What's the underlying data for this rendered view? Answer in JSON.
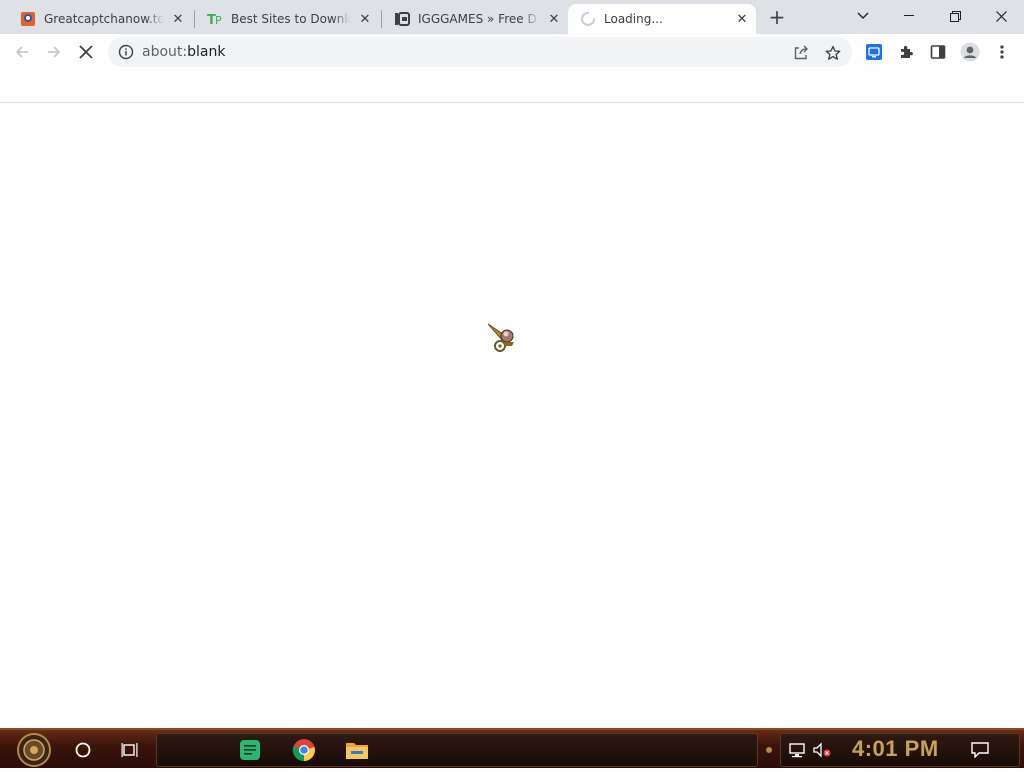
{
  "browser": {
    "tabs": [
      {
        "title": "Greatcaptchanow.top",
        "favicon": "captcha-favicon",
        "active": false
      },
      {
        "title": "Best Sites to Download",
        "favicon": "tp-favicon",
        "active": false
      },
      {
        "title": "IGGGAMES » Free D",
        "favicon": "igg-favicon",
        "active": false
      },
      {
        "title": "Loading...",
        "favicon": "loading-spinner-icon",
        "active": true
      }
    ],
    "new_tab_label": "+",
    "address": {
      "scheme": "about:",
      "rest": "blank"
    }
  },
  "taskbar": {
    "clock": "4:01 PM",
    "pinned": [
      "cortana-icon",
      "task-view-icon",
      "notes-app-icon",
      "chrome-icon",
      "file-explorer-icon"
    ]
  },
  "colors": {
    "tabstrip_bg": "#dee1e6",
    "omnibox_bg": "#f1f3f4",
    "taskbar_bg": "#3a140a",
    "clock_color": "#c9a25a"
  }
}
